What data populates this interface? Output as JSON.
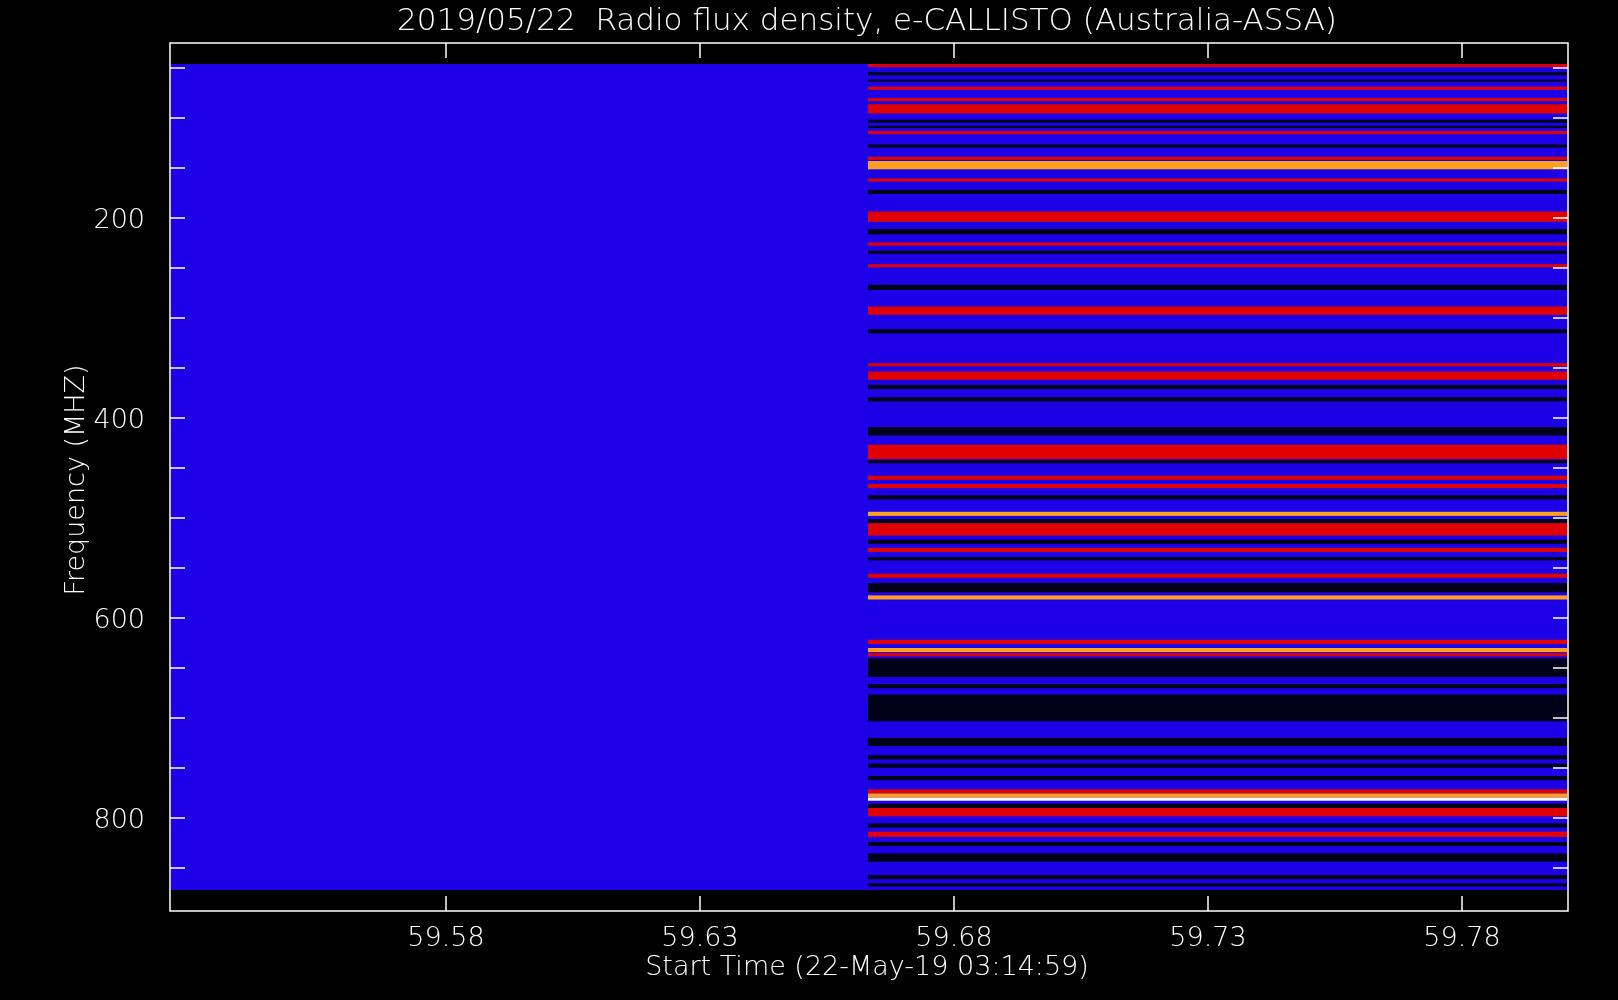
{
  "title": "2019/05/22  Radio flux density, e-CALLISTO (Australia-ASSA)",
  "x_axis": {
    "label": "Start Time (22-May-19 03:14:59)",
    "ticks": [
      "59.58",
      "59.63",
      "59.68",
      "59.73",
      "59.78"
    ]
  },
  "y_axis": {
    "label": "Frequency (MHZ)",
    "ticks": [
      "200",
      "400",
      "600",
      "800"
    ]
  }
}
